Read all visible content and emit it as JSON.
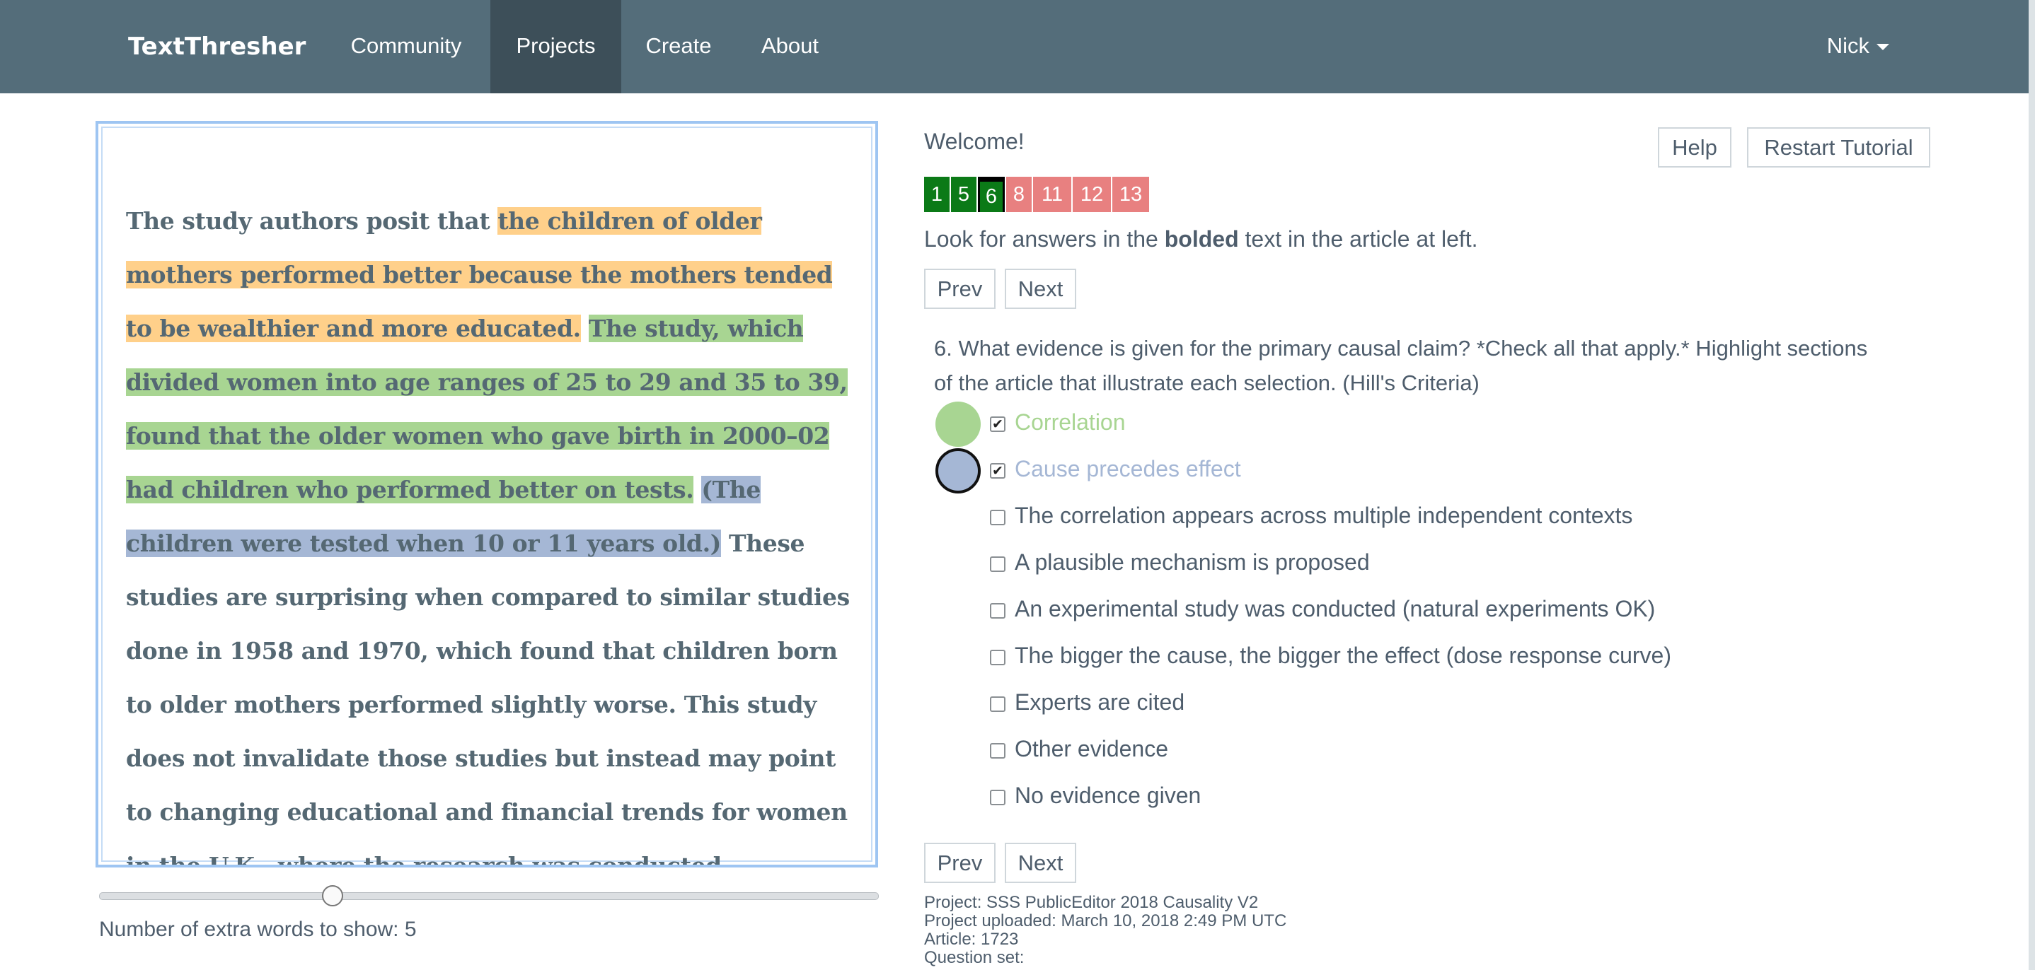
{
  "navbar": {
    "brand": "TextThresher",
    "items": [
      "Community",
      "Projects",
      "Create",
      "About"
    ],
    "active": "Projects",
    "user": "Nick"
  },
  "article": {
    "segments": [
      {
        "text": "The study authors posit that ",
        "hl": ""
      },
      {
        "text": "the children of older mothers performed better because the mothers tended to be wealthier and more educated.",
        "hl": "orange"
      },
      {
        "text": " ",
        "hl": ""
      },
      {
        "text": "The study, which divided women into age ranges of 25 to 29 and 35 to 39, found that the older women who gave birth in 2000–02 had children who performed better on tests.",
        "hl": "green"
      },
      {
        "text": " ",
        "hl": ""
      },
      {
        "text": "(The children were tested when 10 or 11 years old.)",
        "hl": "blue"
      },
      {
        "text": " These studies are surprising when compared to similar studies done in 1958 and 1970, which found that children born to older mothers performed slightly worse. This study does not invalidate those studies but instead may point to changing educational and financial trends for women in the U.K., where the research was conducted.",
        "hl": ""
      }
    ],
    "highlight_colors": {
      "orange": "#ffd08a",
      "green": "#a8d592",
      "blue": "#a5b7d5"
    }
  },
  "slider": {
    "label": "Number of extra words to show: 5",
    "value_fraction": 0.3
  },
  "right": {
    "welcome": "Welcome!",
    "help_button": "Help",
    "restart_button": "Restart Tutorial",
    "question_numbers": [
      {
        "label": "1",
        "state": "done"
      },
      {
        "label": "5",
        "state": "done"
      },
      {
        "label": "6",
        "state": "current"
      },
      {
        "label": "8",
        "state": "todo"
      },
      {
        "label": "11",
        "state": "todo"
      },
      {
        "label": "12",
        "state": "todo"
      },
      {
        "label": "13",
        "state": "todo"
      }
    ],
    "instruction_pre": "Look for answers in the ",
    "instruction_bold": "bolded",
    "instruction_post": " text in the article at left.",
    "prev_label": "Prev",
    "next_label": "Next",
    "question": "6.   What evidence is given for the primary causal claim? *Check all that apply.* Highlight sections of the article that illustrate each selection. (Hill's Criteria)",
    "options": [
      {
        "label": "Correlation",
        "checked": true,
        "color": "#a8d592",
        "selected": false
      },
      {
        "label": "Cause precedes effect",
        "checked": true,
        "color": "#a5b7d5",
        "selected": true
      },
      {
        "label": "The correlation appears across multiple independent contexts",
        "checked": false
      },
      {
        "label": "A plausible mechanism is proposed",
        "checked": false
      },
      {
        "label": "An experimental study was conducted (natural experiments OK)",
        "checked": false
      },
      {
        "label": "The bigger the cause, the bigger the effect (dose response curve)",
        "checked": false
      },
      {
        "label": "Experts are cited",
        "checked": false
      },
      {
        "label": "Other evidence",
        "checked": false
      },
      {
        "label": "No evidence given",
        "checked": false
      }
    ],
    "meta": {
      "project": "Project: SSS PublicEditor 2018 Causality V2",
      "uploaded": "Project uploaded: March 10, 2018 2:49 PM UTC",
      "article": "Article: 1723",
      "question_set": "Question set:"
    }
  }
}
